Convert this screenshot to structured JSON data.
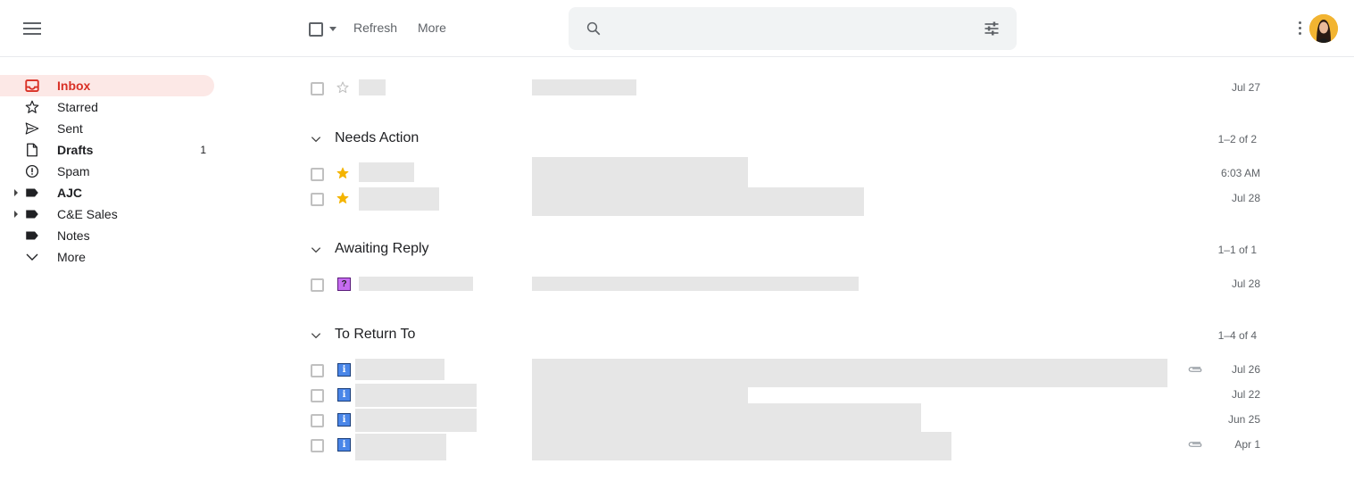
{
  "toolbar": {
    "refresh_label": "Refresh",
    "more_label": "More"
  },
  "search": {
    "placeholder": ""
  },
  "sidebar": {
    "items": [
      {
        "label": "Inbox",
        "count": "",
        "active": true
      },
      {
        "label": "Starred",
        "count": ""
      },
      {
        "label": "Sent",
        "count": ""
      },
      {
        "label": "Drafts",
        "count": "1"
      },
      {
        "label": "Spam",
        "count": ""
      },
      {
        "label": "AJC",
        "count": ""
      },
      {
        "label": "C&E Sales",
        "count": ""
      },
      {
        "label": "Notes",
        "count": ""
      },
      {
        "label": "More",
        "count": ""
      }
    ]
  },
  "inbox_rows": [
    {
      "date": "Jul 27"
    }
  ],
  "sections": [
    {
      "title": "Needs Action",
      "count": "1–2 of 2",
      "rows": [
        {
          "date": "6:03 AM"
        },
        {
          "date": "Jul 28"
        }
      ]
    },
    {
      "title": "Awaiting Reply",
      "count": "1–1 of 1",
      "rows": [
        {
          "date": "Jul 28"
        }
      ]
    },
    {
      "title": "To Return To",
      "count": "1–4 of 4",
      "rows": [
        {
          "date": "Jul 26"
        },
        {
          "date": "Jul 22"
        },
        {
          "date": "Jun 25"
        },
        {
          "date": "Apr 1"
        }
      ]
    }
  ],
  "colors": {
    "accent": "#d93025",
    "active_bg": "#fce8e6",
    "star": "#f4b400",
    "info_badge": "#4a86e8",
    "question_badge": "#c66cf0"
  }
}
